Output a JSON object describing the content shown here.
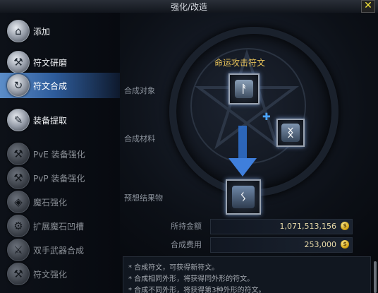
{
  "window": {
    "title": "强化/改造",
    "close_label": "✕"
  },
  "sidebar": {
    "items": [
      {
        "label": "添加",
        "icon": "house-icon",
        "active": true
      },
      {
        "label": "符文研磨",
        "icon": "anvil-icon",
        "active": true
      },
      {
        "label": "符文合成",
        "icon": "cycle-icon",
        "active": true,
        "selected": true
      },
      {
        "label": "装备提取",
        "icon": "tools-icon",
        "active": true
      },
      {
        "label": "PvE 装备强化",
        "icon": "anvil-icon",
        "active": false
      },
      {
        "label": "PvP 装备强化",
        "icon": "anvil-icon",
        "active": false
      },
      {
        "label": "魔石强化",
        "icon": "stone-icon",
        "active": false
      },
      {
        "label": "扩展魔石凹槽",
        "icon": "stone-socket-icon",
        "active": false
      },
      {
        "label": "双手武器合成",
        "icon": "sword-icon",
        "active": false
      },
      {
        "label": "符文强化",
        "icon": "anvil-icon",
        "active": false
      }
    ]
  },
  "main": {
    "target_label": "合成对象",
    "material_label": "合成材料",
    "result_label": "预想结果物",
    "target_item_name": "命运攻击符文",
    "funds_label": "所持金额",
    "funds_value": "1,071,513,156",
    "cost_label": "合成费用",
    "cost_value": "253,000",
    "notes": [
      "* 合成符文，可获得新符文。",
      "* 合成相同外形，将获得同外形的符文。",
      "* 合成不同外形，将获得第3种外形的符文。"
    ]
  },
  "colors": {
    "accent": "#4a7fc0",
    "gold": "#e8c35a",
    "arrow": "#2f6ec9"
  }
}
